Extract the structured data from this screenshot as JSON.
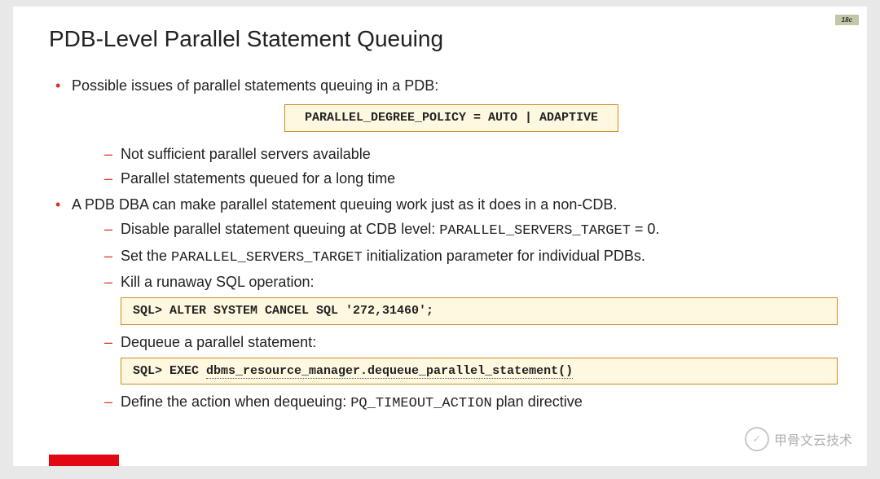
{
  "version_badge": "18c",
  "title": "PDB-Level Parallel Statement Queuing",
  "b1": {
    "text": "Possible issues of parallel statements queuing in a PDB:",
    "codebox": "PARALLEL_DEGREE_POLICY = AUTO | ADAPTIVE",
    "s1": "Not sufficient parallel servers available",
    "s2": "Parallel statements queued for a long time"
  },
  "b2": {
    "text": "A PDB DBA can make parallel statement queuing work just as it does in a non-CDB.",
    "s1_a": "Disable parallel statement queuing at CDB level: ",
    "s1_code": "PARALLEL_SERVERS_TARGET",
    "s1_b": " = 0.",
    "s2_a": "Set the ",
    "s2_code": "PARALLEL_SERVERS_TARGET",
    "s2_b": " initialization parameter for individual PDBs.",
    "s3": "Kill a runaway SQL operation:",
    "s3_code": "SQL> ALTER SYSTEM CANCEL SQL '272,31460';",
    "s4": "Dequeue a parallel statement:",
    "s4_code_a": "SQL> EXEC ",
    "s4_code_b": "dbms_resource_manager.dequeue_parallel_statement()",
    "s5_a": "Define the action when dequeuing: ",
    "s5_code": "PQ_TIMEOUT_ACTION",
    "s5_b": " plan directive"
  },
  "watermark": {
    "icon": "✓",
    "text": "甲骨文云技术"
  }
}
